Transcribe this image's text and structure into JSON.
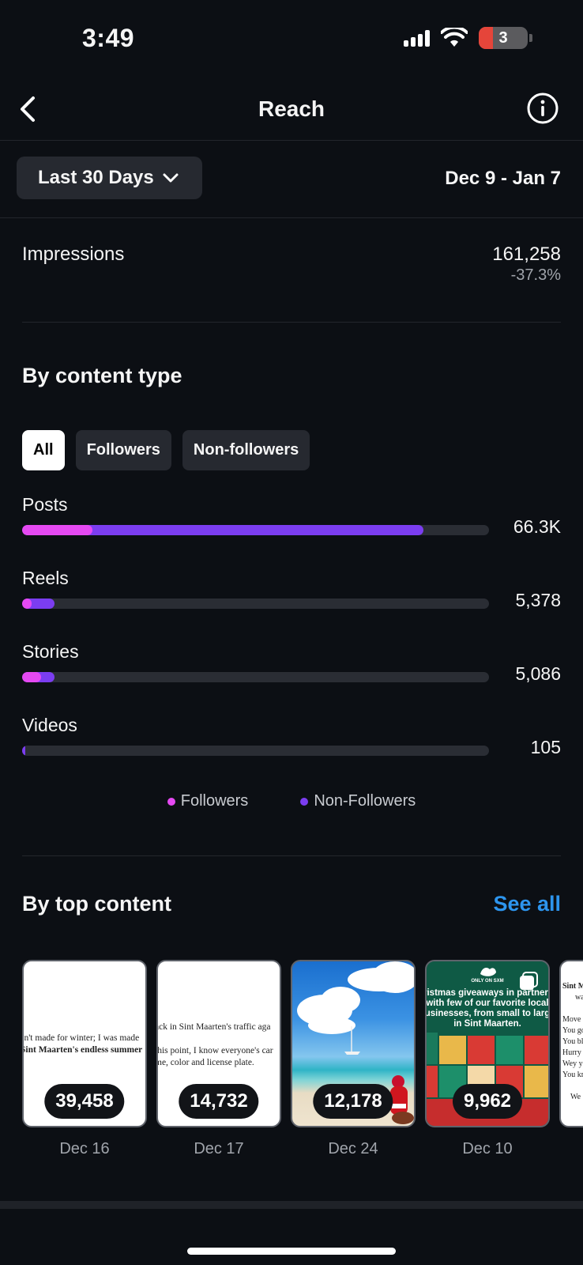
{
  "status": {
    "time": "3:49",
    "battery": "3"
  },
  "nav": {
    "title": "Reach"
  },
  "filter": {
    "range_label": "Last 30 Days",
    "date_range": "Dec 9 - Jan 7"
  },
  "impressions": {
    "label": "Impressions",
    "value": "161,258",
    "change": "-37.3%"
  },
  "content_type": {
    "title": "By content type",
    "tabs": [
      {
        "label": "All",
        "active": true
      },
      {
        "label": "Followers",
        "active": false
      },
      {
        "label": "Non-followers",
        "active": false
      }
    ],
    "metrics": [
      {
        "name": "Posts",
        "value": "66.3K",
        "followers_fraction": 0.15,
        "non_followers_fraction": 0.71
      },
      {
        "name": "Reels",
        "value": "5,378",
        "followers_fraction": 0.02,
        "non_followers_fraction": 0.05
      },
      {
        "name": "Stories",
        "value": "5,086",
        "followers_fraction": 0.04,
        "non_followers_fraction": 0.03
      },
      {
        "name": "Videos",
        "value": "105",
        "followers_fraction": 0.0,
        "non_followers_fraction": 0.003
      }
    ],
    "legend": [
      {
        "label": "Followers",
        "color": "#e549f2"
      },
      {
        "label": "Non-Followers",
        "color": "#7b3df0"
      }
    ]
  },
  "top_content": {
    "title": "By top content",
    "see_all": "See all",
    "cards": [
      {
        "count": "39,458",
        "date": "Dec 16",
        "text_lines": [
          "sn't made for winter; I was made",
          "Sint Maarten's endless summer"
        ]
      },
      {
        "count": "14,732",
        "date": "Dec 17",
        "text_lines": [
          "ack in Sint Maarten's traffic aga",
          "this point, I know everyone's car",
          "me, color and license plate."
        ]
      },
      {
        "count": "12,178",
        "date": "Dec 24"
      },
      {
        "count": "9,962",
        "date": "Dec 10",
        "text_lines": [
          "ONLY ON SXM",
          "ristmas giveaways in partners",
          "with few of our favorite local",
          "usinesses, from small to larg",
          "in Sint Maarten."
        ]
      }
    ],
    "partial_card_lines": [
      "Sint M",
      "wa",
      "Move t",
      "You go",
      "You bl",
      "Hurry",
      "Wey yc",
      "You kn",
      "We d"
    ]
  },
  "colors": {
    "followers": "#e549f2",
    "non_followers": "#7b3df0",
    "accent_link": "#2d95ee",
    "background": "#0c0f14"
  },
  "icons": [
    "signal-icon",
    "wifi-icon",
    "battery-icon",
    "back-chevron-icon",
    "info-icon",
    "chevron-down-icon"
  ]
}
